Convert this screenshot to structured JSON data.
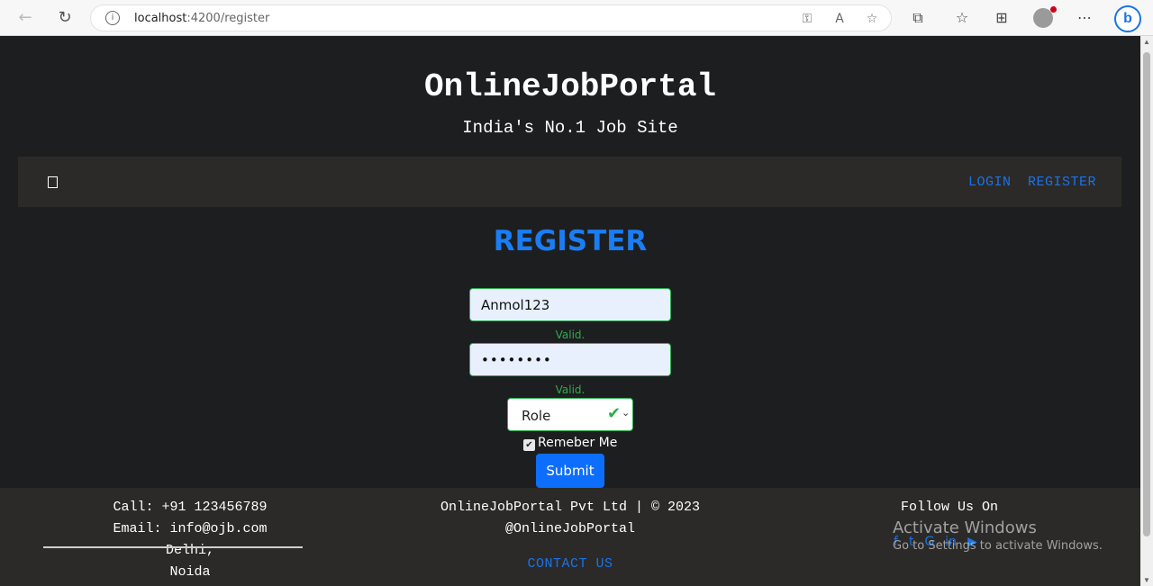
{
  "browser": {
    "url_host": "localhost",
    "url_path": ":4200/register",
    "back_icon": "arrow-left-icon",
    "reload_icon": "reload-icon"
  },
  "site": {
    "brand": "OnlineJobPortal",
    "tagline": "India's No.1 Job Site"
  },
  "navbar": {
    "links": [
      "LOGIN",
      "REGISTER"
    ]
  },
  "form": {
    "title": "REGISTER",
    "username_value": "Anmol123",
    "password_value": "••••••••",
    "valid_text": "Valid.",
    "role_value": "Role",
    "remember_label": "Remeber Me",
    "remember_checked": true,
    "submit_label": "Submit"
  },
  "footer": {
    "call": "Call: +91 123456789",
    "email": "Email: info@ojb.com",
    "city1": "Delhi,",
    "city2": "Noida",
    "company": "OnlineJobPortal Pvt Ltd | © 2023",
    "handle": "@OnlineJobPortal",
    "contact_link": "CONTACT US",
    "follow": "Follow Us On",
    "social_icons": [
      "facebook-icon",
      "twitter-icon",
      "google-icon",
      "linkedin-icon",
      "youtube-icon"
    ]
  },
  "watermark": {
    "line1": "Activate Windows",
    "line2": "Go to Settings to activate Windows."
  },
  "colors": {
    "accent": "#1a7df4",
    "valid": "#2dad4e",
    "page_bg": "#1d1e20",
    "bar_bg": "#2b2a28"
  }
}
